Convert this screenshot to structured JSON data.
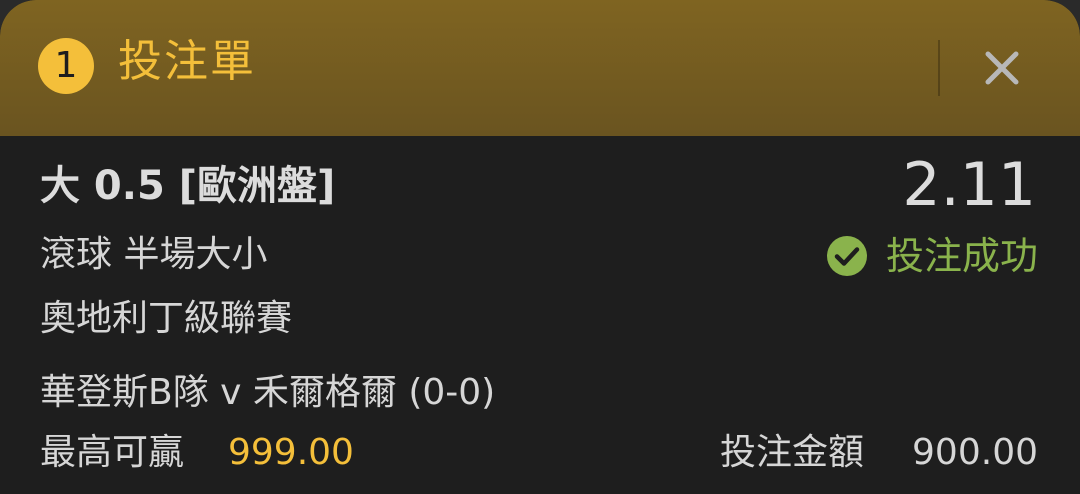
{
  "header": {
    "count": "1",
    "title": "投注單",
    "close_icon": "close-icon"
  },
  "bet": {
    "selection": "大 0.5 [歐洲盤]",
    "odds": "2.11",
    "market": "滾球 半場大小",
    "status": "投注成功",
    "status_icon": "check-circle-icon",
    "league": "奧地利丁級聯賽",
    "match": "華登斯B隊 v 禾爾格爾 (0-0)",
    "max_win_label": "最高可贏",
    "max_win_value": "999.00",
    "stake_label": "投注金額",
    "stake_value": "900.00"
  },
  "colors": {
    "header_bg": "#7f6421",
    "accent": "#f4bf3a",
    "success": "#8ab34c",
    "panel_bg": "#1e1e1e",
    "text": "#d6d6d6"
  }
}
